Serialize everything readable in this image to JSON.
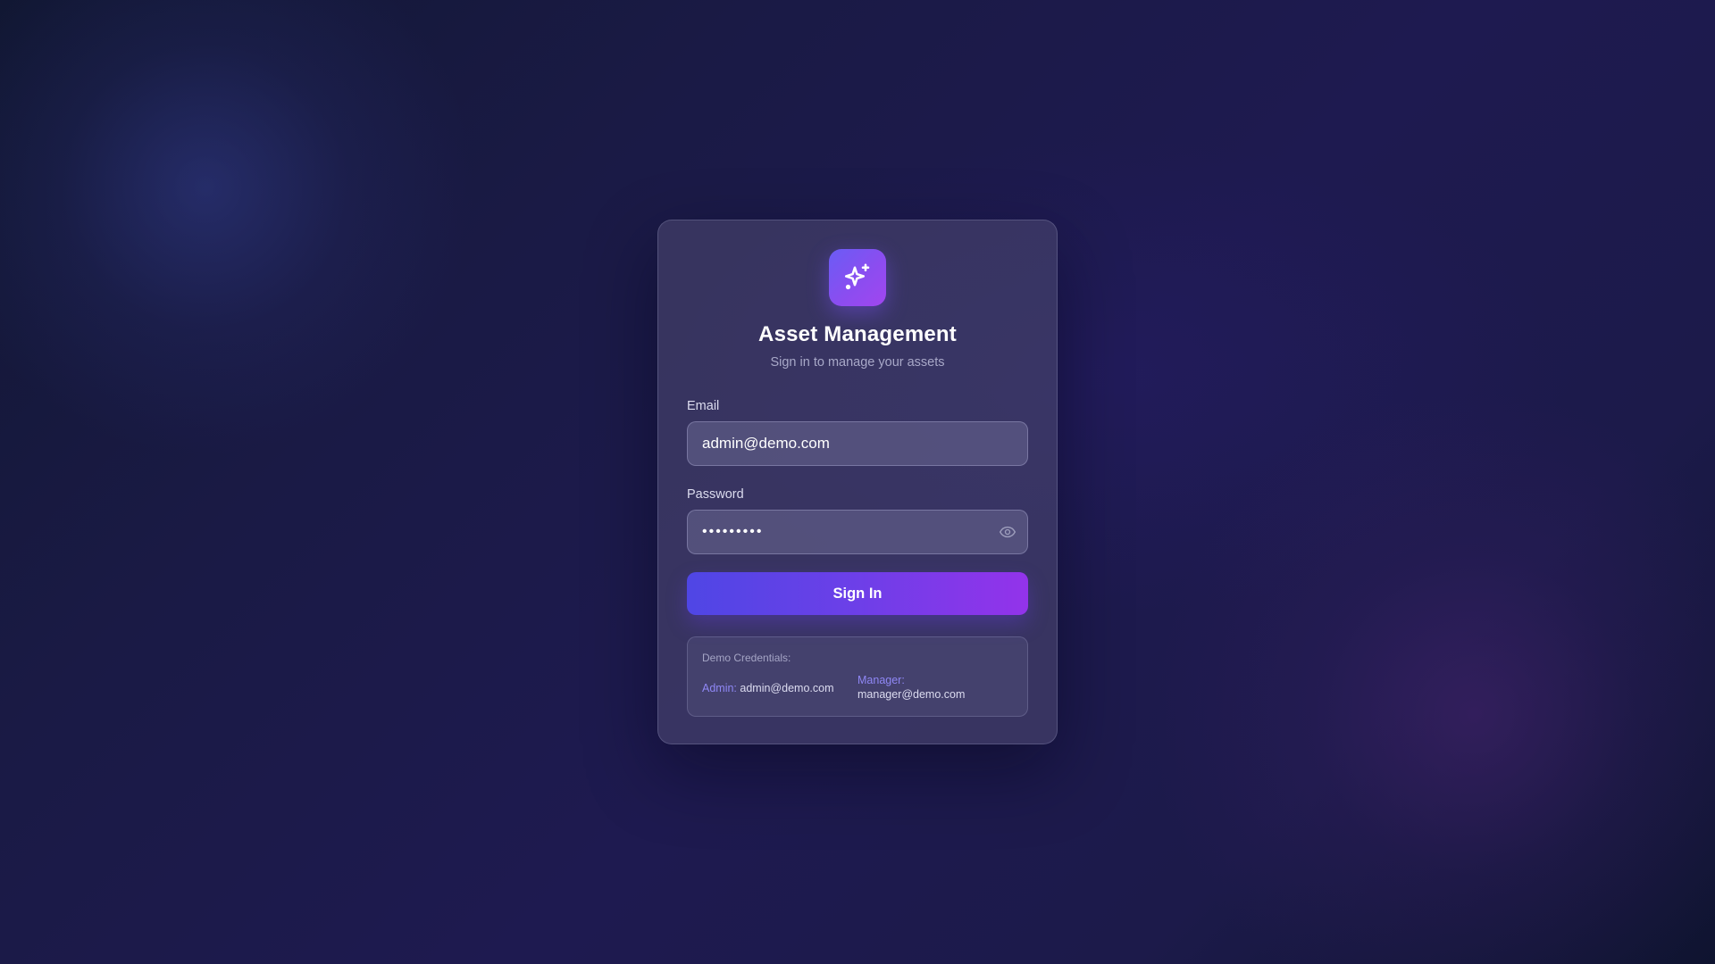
{
  "app": {
    "title": "Asset Management",
    "subtitle": "Sign in to manage your assets",
    "logo_icon": "sparkles-icon",
    "accent_colors": [
      "#4f46e5",
      "#9333ea"
    ]
  },
  "form": {
    "email": {
      "label": "Email",
      "value": "admin@demo.com"
    },
    "password": {
      "label": "Password",
      "value": "password1",
      "toggle_icon": "eye-icon"
    },
    "submit_label": "Sign In"
  },
  "demo": {
    "title": "Demo Credentials:",
    "admin": {
      "label": "Admin:",
      "email": "admin@demo.com"
    },
    "manager": {
      "label": "Manager:",
      "email": "manager@demo.com"
    }
  }
}
